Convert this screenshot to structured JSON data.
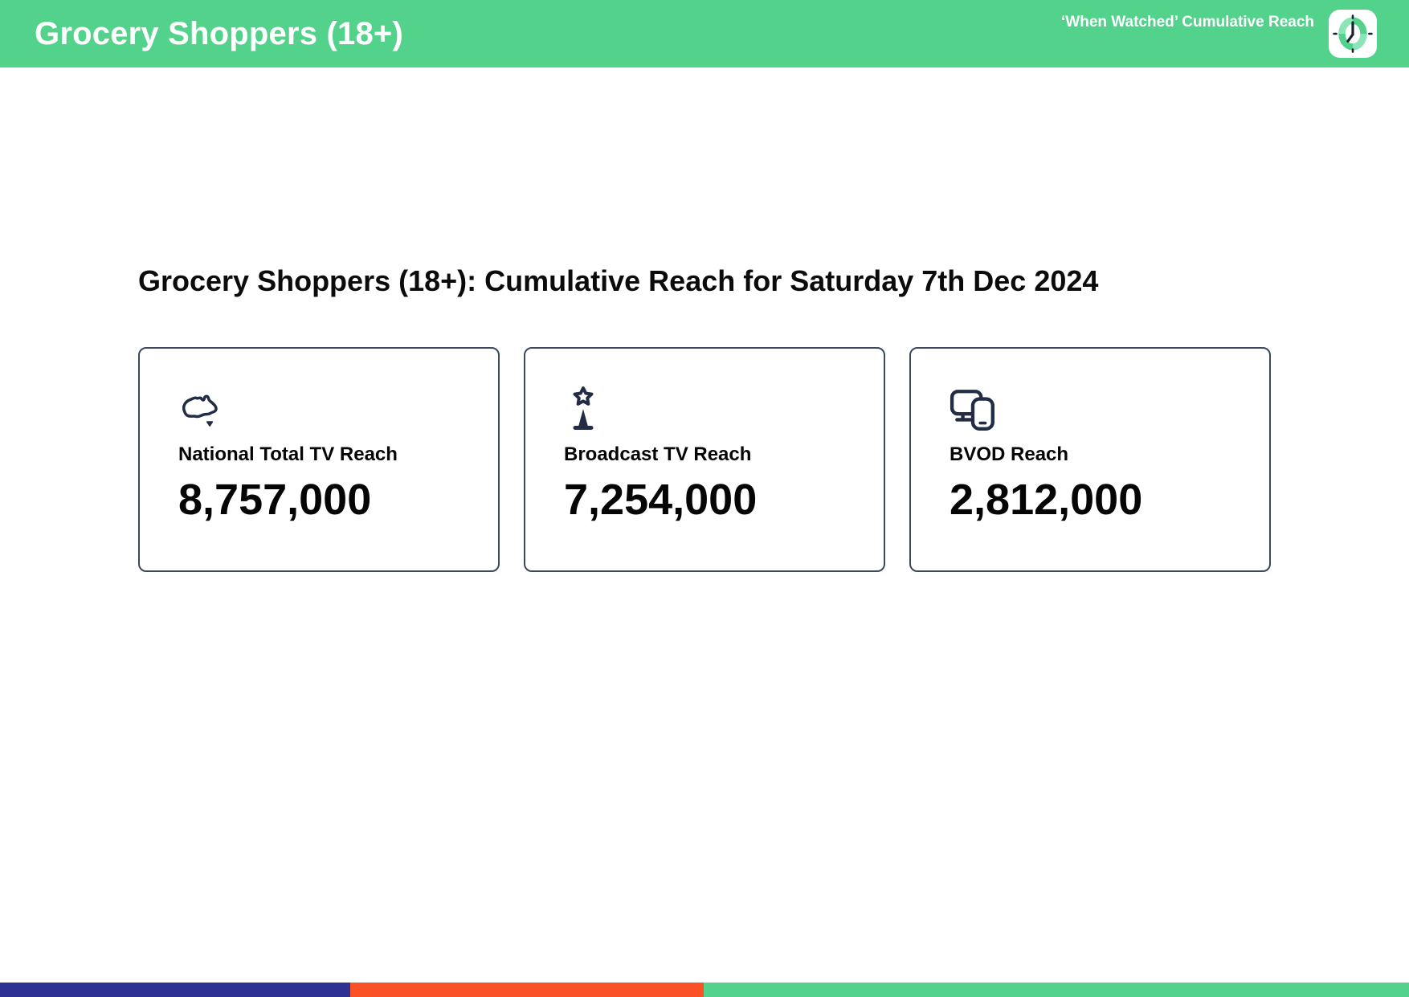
{
  "header": {
    "title": "Grocery Shoppers (18+)",
    "subtitle": "‘When Watched’ Cumulative Reach",
    "logo_icon": "clock-logo-icon"
  },
  "main": {
    "heading": "Grocery Shoppers (18+): Cumulative Reach for Saturday 7th Dec 2024",
    "cards": [
      {
        "icon": "australia-map-icon",
        "label": "National Total TV Reach",
        "value": "8,757,000"
      },
      {
        "icon": "broadcast-tower-icon",
        "label": "Broadcast TV Reach",
        "value": "7,254,000"
      },
      {
        "icon": "tv-and-phone-devices-icon",
        "label": "BVOD Reach",
        "value": "2,812,000"
      }
    ]
  },
  "footer": {
    "segments": [
      {
        "name": "blue-segment",
        "color": "#2e3192",
        "width_pct": 24.86
      },
      {
        "name": "orange-segment",
        "color": "#fa5226",
        "width_pct": 25.08
      },
      {
        "name": "green-segment",
        "color": "#53d28b",
        "width_pct": 50.06
      }
    ]
  },
  "colors": {
    "header_green": "#53d28b",
    "icon_navy": "#222c44",
    "card_border": "#3b495c"
  }
}
